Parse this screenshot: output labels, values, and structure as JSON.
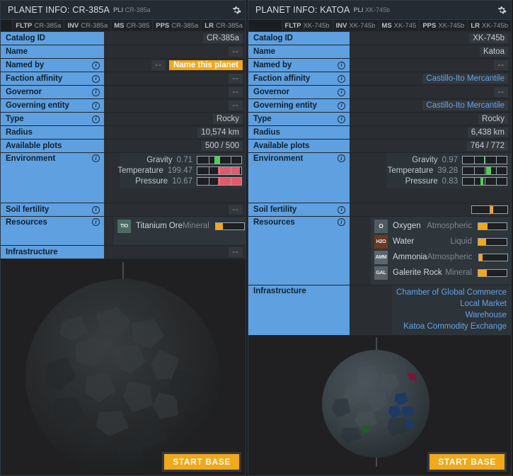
{
  "panels": [
    {
      "title_main": "PLANET INFO: CR-385A",
      "title_pli": "PLI",
      "title_id": "CR-385a",
      "gear_icon": "gear-icon",
      "idchips": [
        {
          "tag": "FLTP",
          "id": "CR-385a"
        },
        {
          "tag": "INV",
          "id": "CR-385a"
        },
        {
          "tag": "MS",
          "id": "CR-385"
        },
        {
          "tag": "PPS",
          "id": "CR-385a"
        },
        {
          "tag": "LR",
          "id": "CR-385a"
        }
      ],
      "rows": [
        {
          "label": "Catalog ID",
          "info": false,
          "value": "CR-385a"
        },
        {
          "label": "Name",
          "info": false,
          "value": "--",
          "dash": true
        },
        {
          "label": "Named by",
          "info": true,
          "value": "--",
          "dash": true,
          "button": "Name this planet"
        },
        {
          "label": "Faction affinity",
          "info": true,
          "value": "--",
          "dash": true
        },
        {
          "label": "Governor",
          "info": true,
          "value": "--",
          "dash": true
        },
        {
          "label": "Governing entity",
          "info": true,
          "value": "--",
          "dash": true
        },
        {
          "label": "Type",
          "info": true,
          "value": "Rocky"
        },
        {
          "label": "Radius",
          "info": false,
          "value": "10,574 km"
        },
        {
          "label": "Available plots",
          "info": false,
          "value": "500 / 500"
        }
      ],
      "environment": {
        "label": "Environment",
        "gauges": [
          {
            "name": "Gravity",
            "value": "0.71",
            "fill_left": 39,
            "fill_width": 11,
            "color": "#4fd14f"
          },
          {
            "name": "Temperature",
            "value": "199.47",
            "fill_left": 47,
            "fill_width": 50,
            "color": "#e2596a"
          },
          {
            "name": "Pressure",
            "value": "10.67",
            "fill_left": 47,
            "fill_width": 53,
            "color": "#e2596a"
          }
        ]
      },
      "soil_fertility": {
        "label": "Soil fertility",
        "value": "--",
        "dash": true
      },
      "resources": {
        "label": "Resources",
        "items": [
          {
            "code": "TIO",
            "name": "Titanium Ore",
            "type": "Mineral",
            "bar": 26,
            "icon_bg": "#4c6b61"
          }
        ]
      },
      "infrastructure": {
        "label": "Infrastructure",
        "value": "--",
        "dash": true,
        "items": []
      },
      "planet": {
        "body_color": "#2a2c2e",
        "start_base": "START BASE"
      }
    },
    {
      "title_main": "PLANET INFO: KATOA",
      "title_pli": "PLI",
      "title_id": "XK-745b",
      "gear_icon": "gear-icon",
      "idchips": [
        {
          "tag": "FLTP",
          "id": "XK-745b"
        },
        {
          "tag": "INV",
          "id": "XK-745b"
        },
        {
          "tag": "MS",
          "id": "XK-745"
        },
        {
          "tag": "PPS",
          "id": "XK-745b"
        },
        {
          "tag": "LR",
          "id": "XK-745b"
        }
      ],
      "rows": [
        {
          "label": "Catalog ID",
          "info": false,
          "value": "XK-745b"
        },
        {
          "label": "Name",
          "info": false,
          "value": "Katoa"
        },
        {
          "label": "Named by",
          "info": true,
          "value": "--",
          "dash": true
        },
        {
          "label": "Faction affinity",
          "info": true,
          "value": "Castillo-Ito Mercantile",
          "link": true
        },
        {
          "label": "Governor",
          "info": true,
          "value": "--",
          "dash": true
        },
        {
          "label": "Governing entity",
          "info": true,
          "value": "Castillo-Ito Mercantile",
          "link": true
        },
        {
          "label": "Type",
          "info": true,
          "value": "Rocky"
        },
        {
          "label": "Radius",
          "info": false,
          "value": "6,438 km"
        },
        {
          "label": "Available plots",
          "info": false,
          "value": "764 / 772"
        }
      ],
      "environment": {
        "label": "Environment",
        "gauges": [
          {
            "name": "Gravity",
            "value": "0.97",
            "fill_left": 48,
            "fill_width": 4,
            "color": "#4fd14f"
          },
          {
            "name": "Temperature",
            "value": "39.28",
            "fill_left": 53,
            "fill_width": 11,
            "color": "#4fd14f"
          },
          {
            "name": "Pressure",
            "value": "0.83",
            "fill_left": 40,
            "fill_width": 6,
            "color": "#4fd14f"
          }
        ]
      },
      "soil_fertility": {
        "label": "Soil fertility",
        "value": "",
        "bar": 52
      },
      "resources": {
        "label": "Resources",
        "items": [
          {
            "code": "O",
            "name": "Oxygen",
            "type": "Atmospheric",
            "bar": 33,
            "icon_bg": "#525a61"
          },
          {
            "code": "H2O",
            "name": "Water",
            "type": "Liquid",
            "bar": 28,
            "icon_bg": "#6b3a21"
          },
          {
            "code": "AMM",
            "name": "Ammonia",
            "type": "Atmospheric",
            "bar": 13,
            "icon_bg": "#5c6670"
          },
          {
            "code": "GAL",
            "name": "Galerite Rock",
            "type": "Mineral",
            "bar": 30,
            "icon_bg": "#5a6168"
          }
        ]
      },
      "infrastructure": {
        "label": "Infrastructure",
        "items": [
          "Chamber of Global Commerce",
          "Local Market",
          "Warehouse",
          "Katoa Commodity Exchange"
        ]
      },
      "planet": {
        "body_color": "#3b4348",
        "start_base": "START BASE"
      }
    }
  ],
  "chart_data": {
    "type": "bar",
    "title": "Planet environment gauges",
    "series": [
      {
        "name": "CR-385a",
        "categories": [
          "Gravity",
          "Temperature",
          "Pressure"
        ],
        "values": [
          0.71,
          199.47,
          10.67
        ]
      },
      {
        "name": "Katoa",
        "categories": [
          "Gravity",
          "Temperature",
          "Pressure"
        ],
        "values": [
          0.97,
          39.28,
          0.83
        ]
      }
    ]
  },
  "colors": {
    "accent_blue": "#5ea0e0",
    "accent_orange": "#f0a81c",
    "gauge_good": "#4fd14f",
    "gauge_bad": "#e2596a",
    "panel_bg": "#222528",
    "value_bg": "#2a2d31"
  }
}
